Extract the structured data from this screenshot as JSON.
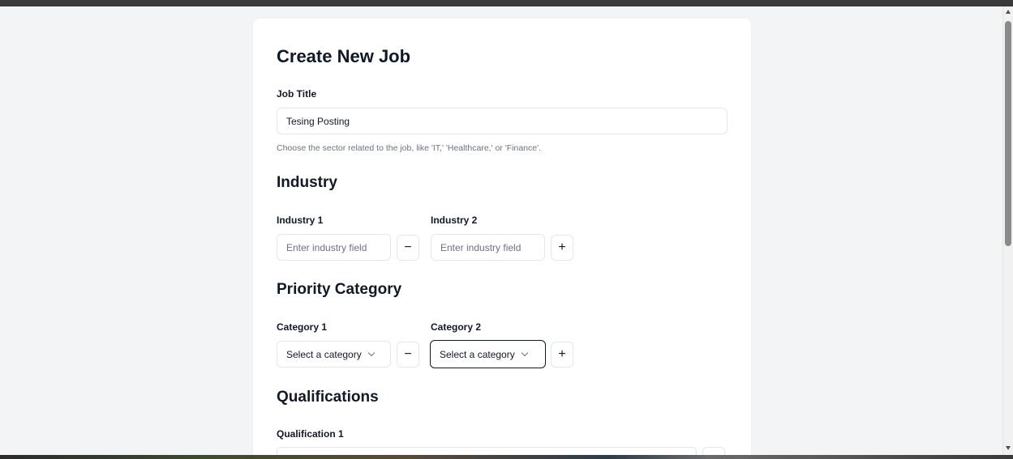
{
  "form": {
    "title": "Create New Job",
    "job_title_label": "Job Title",
    "job_title_value": "Tesing Posting",
    "job_title_help": "Choose the sector related to the job, like 'IT,' 'Healthcare,' or 'Finance'."
  },
  "industry": {
    "heading": "Industry",
    "items": [
      {
        "label": "Industry 1",
        "placeholder": "Enter industry field",
        "button": "−"
      },
      {
        "label": "Industry 2",
        "placeholder": "Enter industry field",
        "button": "+"
      }
    ]
  },
  "priority": {
    "heading": "Priority Category",
    "items": [
      {
        "label": "Category 1",
        "value": "Select a category",
        "button": "−"
      },
      {
        "label": "Category 2",
        "value": "Select a category",
        "button": "+"
      }
    ]
  },
  "qualifications": {
    "heading": "Qualifications",
    "items": [
      {
        "label": "Qualification 1"
      }
    ]
  },
  "icons": {
    "minus": "minus-icon",
    "plus": "plus-icon",
    "chevron": "chevron-down-icon"
  },
  "colors": {
    "page_bg": "#f3f4f6",
    "card_bg": "#ffffff",
    "text": "#111827",
    "muted": "#6b7280",
    "border": "#e5e7eb"
  }
}
